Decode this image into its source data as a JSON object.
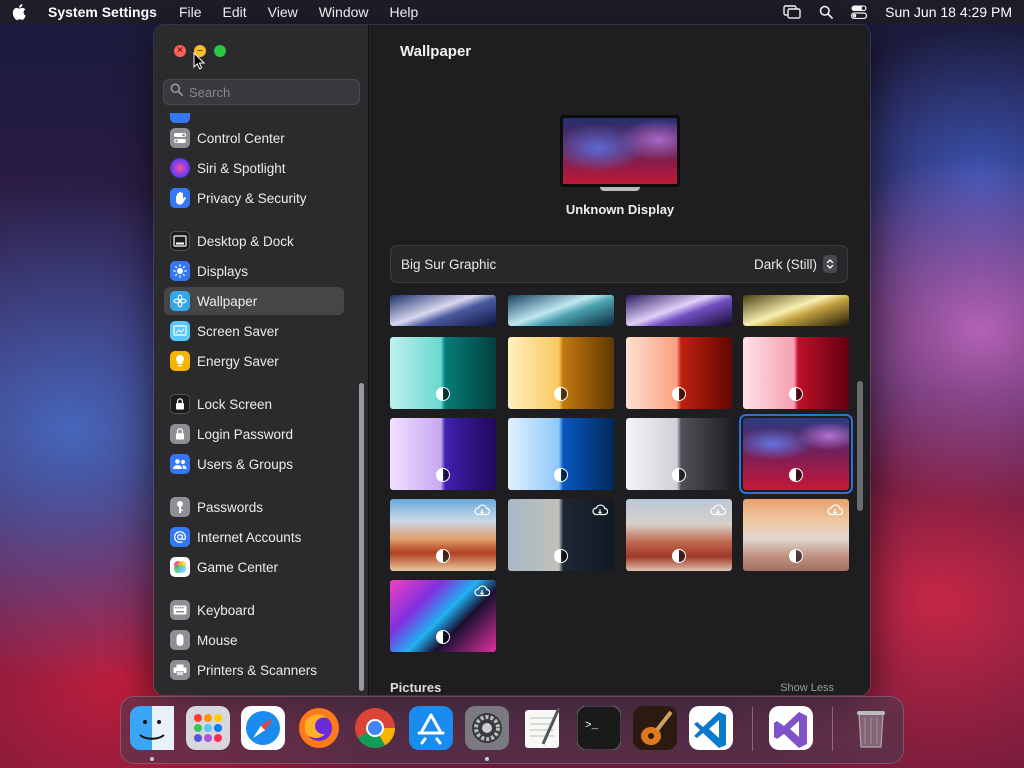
{
  "menubar": {
    "app_name": "System Settings",
    "menus": [
      "File",
      "Edit",
      "View",
      "Window",
      "Help"
    ],
    "clock": "Sun Jun 18  4:29 PM"
  },
  "sidebar": {
    "search_placeholder": "Search",
    "items": [
      {
        "label": "Control Center",
        "icon": "control-center-icon",
        "color": "#8e8e93"
      },
      {
        "label": "Siri & Spotlight",
        "icon": "siri-icon",
        "color": "#b04fd9"
      },
      {
        "label": "Privacy & Security",
        "icon": "hand-icon",
        "color": "#3478f6"
      },
      {
        "label": "Desktop & Dock",
        "icon": "dock-icon",
        "color": "#1c1c1e"
      },
      {
        "label": "Displays",
        "icon": "sun-icon",
        "color": "#3478f6"
      },
      {
        "label": "Wallpaper",
        "icon": "flower-icon",
        "color": "#35a7e8"
      },
      {
        "label": "Screen Saver",
        "icon": "screen-saver-icon",
        "color": "#5ac8fa"
      },
      {
        "label": "Energy Saver",
        "icon": "bulb-icon",
        "color": "#f5b400"
      },
      {
        "label": "Lock Screen",
        "icon": "lock-icon",
        "color": "#1c1c1e"
      },
      {
        "label": "Login Password",
        "icon": "lock-icon",
        "color": "#8e8e93"
      },
      {
        "label": "Users & Groups",
        "icon": "users-icon",
        "color": "#3478f6"
      },
      {
        "label": "Passwords",
        "icon": "key-icon",
        "color": "#8e8e93"
      },
      {
        "label": "Internet Accounts",
        "icon": "at-icon",
        "color": "#3478f6"
      },
      {
        "label": "Game Center",
        "icon": "game-center-icon",
        "color": "#ffffff"
      },
      {
        "label": "Keyboard",
        "icon": "keyboard-icon",
        "color": "#8e8e93"
      },
      {
        "label": "Mouse",
        "icon": "mouse-icon",
        "color": "#8e8e93"
      },
      {
        "label": "Printers & Scanners",
        "icon": "printer-icon",
        "color": "#8e8e93"
      }
    ],
    "selected": "Wallpaper"
  },
  "main": {
    "title": "Wallpaper",
    "display_name": "Unknown Display",
    "wallpaper_name": "Big Sur Graphic",
    "wallpaper_mode": "Dark (Still)",
    "section_label": "Pictures",
    "section_toggle": "Show Less"
  },
  "dock": {
    "apps": [
      "Finder",
      "Launchpad",
      "Safari",
      "Firefox",
      "Chrome",
      "App Store",
      "System Settings",
      "TextEdit",
      "Terminal",
      "GarageBand",
      "Visual Studio Code",
      "Visual Studio",
      "Trash"
    ]
  },
  "colors": {
    "accent": "#2f6fd8",
    "sidebar_bg": "#2b2b2e",
    "main_bg": "#1e1e20"
  }
}
